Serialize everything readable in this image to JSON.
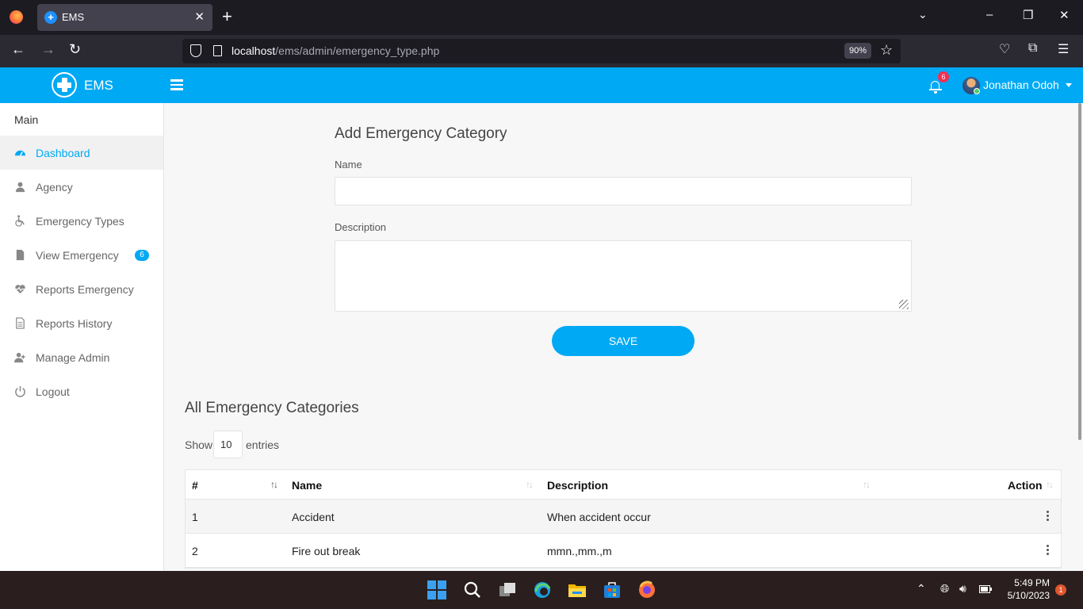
{
  "browser": {
    "tab_title": "EMS",
    "url_host": "localhost",
    "url_path": "/ems/admin/emergency_type.php",
    "zoom": "90%"
  },
  "header": {
    "brand": "EMS",
    "notification_count": "6",
    "user_name": "Jonathan Odoh"
  },
  "sidebar": {
    "section": "Main",
    "items": [
      {
        "label": "Dashboard",
        "icon": "dashboard-icon"
      },
      {
        "label": "Agency",
        "icon": "user-icon"
      },
      {
        "label": "Emergency Types",
        "icon": "wheelchair-icon"
      },
      {
        "label": "View Emergency",
        "icon": "file-icon",
        "badge": "6"
      },
      {
        "label": "Reports Emergency",
        "icon": "heartbeat-icon"
      },
      {
        "label": "Reports History",
        "icon": "document-icon"
      },
      {
        "label": "Manage Admin",
        "icon": "user-plus-icon"
      },
      {
        "label": "Logout",
        "icon": "power-icon"
      }
    ]
  },
  "form": {
    "title": "Add Emergency Category",
    "name_label": "Name",
    "description_label": "Description",
    "save_label": "SAVE"
  },
  "list": {
    "title": "All Emergency Categories",
    "show_label": "Show",
    "page_size": "10",
    "entries_label": "entries",
    "columns": [
      "#",
      "Name",
      "Description",
      "Action"
    ],
    "rows": [
      {
        "num": "1",
        "name": "Accident",
        "description": "When accident occur"
      },
      {
        "num": "2",
        "name": "Fire out break",
        "description": "mmn.,mm.,m"
      }
    ]
  },
  "taskbar": {
    "time": "5:49 PM",
    "date": "5/10/2023",
    "notification_count": "1"
  },
  "colors": {
    "accent": "#00a9f4",
    "badge_red": "#f62d51"
  }
}
